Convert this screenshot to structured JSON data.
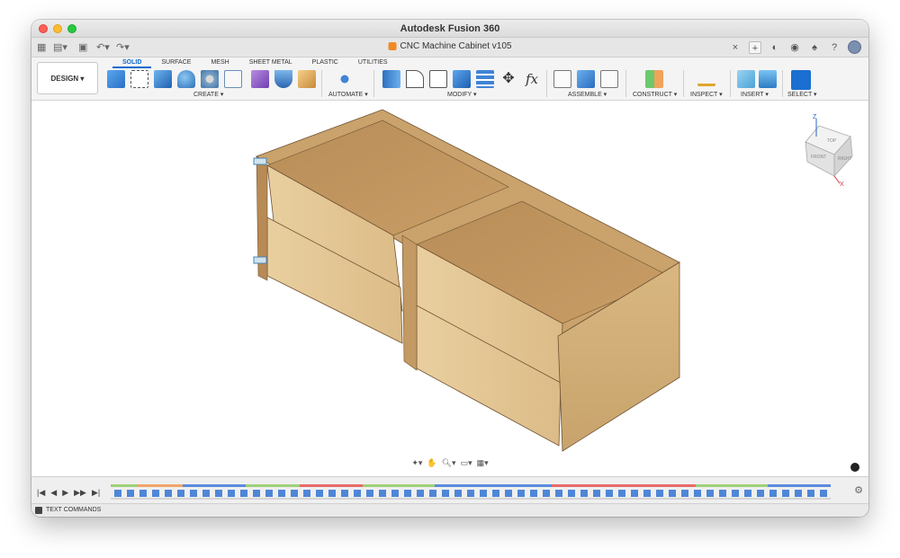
{
  "window": {
    "title": "Autodesk Fusion 360"
  },
  "document": {
    "tab_title": "CNC Machine Cabinet v105"
  },
  "toolbar": {
    "workspace_button": "DESIGN ▾",
    "tabs": [
      "SOLID",
      "SURFACE",
      "MESH",
      "SHEET METAL",
      "PLASTIC",
      "UTILITIES"
    ],
    "active_tab": "SOLID",
    "groups": [
      "CREATE ▾",
      "AUTOMATE ▾",
      "MODIFY ▾",
      "ASSEMBLE ▾",
      "CONSTRUCT ▾",
      "INSPECT ▾",
      "INSERT ▾",
      "SELECT ▾"
    ]
  },
  "viewcube": {
    "top": "TOP",
    "front": "FRONT",
    "right": "RIGHT",
    "z": "Z",
    "x": "X"
  },
  "nav": {
    "icons": [
      "orbit-icon",
      "pan-icon",
      "zoom-icon",
      "display-icon",
      "grid-icon"
    ]
  },
  "timeline": {
    "controls": [
      "|◀",
      "◀",
      "▶",
      "▶▶",
      "▶|"
    ]
  },
  "command_bar": {
    "label": "TEXT COMMANDS"
  },
  "colors": {
    "accent": "#0e6bd0",
    "wood_light": "#e6c79a",
    "wood_mid": "#c9a06a",
    "wood_dark": "#9c7447"
  }
}
